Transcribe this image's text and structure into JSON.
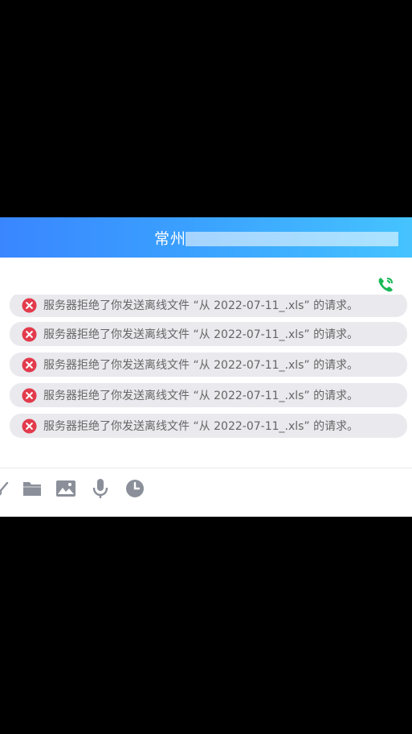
{
  "header": {
    "title": "常州"
  },
  "messages": [
    {
      "text": "服务器拒绝了你发送离线文件 “从 2022-07-11_.xls” 的请求。",
      "icon": "error-icon"
    },
    {
      "text": "服务器拒绝了你发送离线文件 “从 2022-07-11_.xls” 的请求。",
      "icon": "error-icon"
    },
    {
      "text": "服务器拒绝了你发送离线文件 “从 2022-07-11_.xls” 的请求。",
      "icon": "error-icon"
    },
    {
      "text": "服务器拒绝了你发送离线文件 “从 2022-07-11_.xls” 的请求。",
      "icon": "error-icon"
    },
    {
      "text": "服务器拒绝了你发送离线文件 “从 2022-07-11_.xls” 的请求。",
      "icon": "error-icon"
    }
  ],
  "toolbar": {
    "icons": [
      "scissors-icon",
      "folder-icon",
      "image-icon",
      "microphone-icon",
      "clock-icon"
    ]
  },
  "colors": {
    "header_start": "#3a86ff",
    "header_end": "#45c3ff",
    "error_red": "#e23b4c",
    "phone_green": "#19b955",
    "bubble_bg": "#e9e9ee",
    "icon_gray": "#8a8f99"
  }
}
